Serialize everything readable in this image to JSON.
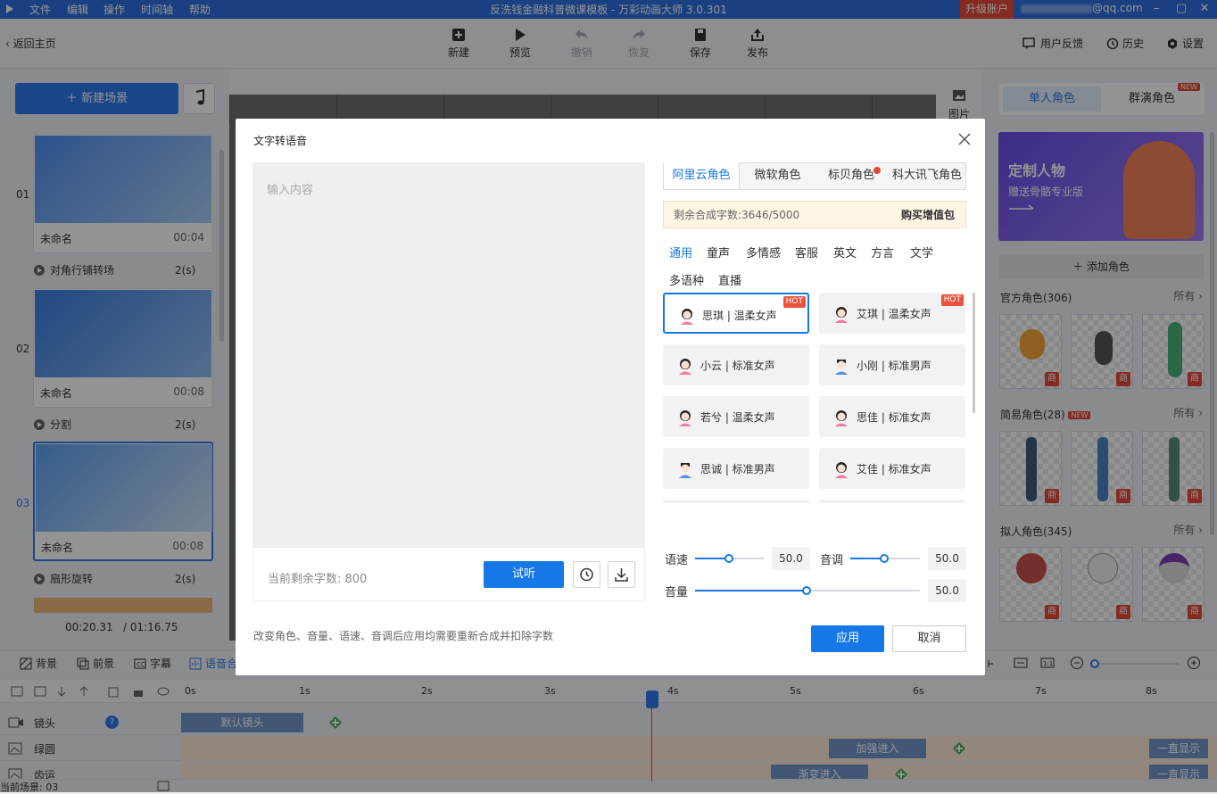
{
  "window": {
    "menus": [
      "文件",
      "编辑",
      "操作",
      "时间轴",
      "帮助"
    ],
    "title": "反洗钱金融科普微课模板 - 万彩动画大师 3.0.301",
    "upgrade": "升级账户",
    "account_suffix": "@qq.com"
  },
  "toolbar": {
    "back": "返回主页",
    "new": "新建",
    "preview": "预览",
    "undo": "撤销",
    "redo": "恢复",
    "save": "保存",
    "publish": "发布",
    "feedback": "用户反馈",
    "history": "历史",
    "settings": "设置"
  },
  "left": {
    "new_scene": "新建场景",
    "scenes": [
      {
        "num": "01",
        "name": "未命名",
        "time": "00:04",
        "trans": "对角行铺转场",
        "dur": "2(s)"
      },
      {
        "num": "02",
        "name": "未命名",
        "time": "00:08",
        "trans": "分割",
        "dur": "2(s)"
      },
      {
        "num": "03",
        "name": "未命名",
        "time": "00:08",
        "trans": "扇形旋转",
        "dur": "2(s)"
      }
    ],
    "current_time": "00:20.31",
    "total_time": "/ 01:16.75"
  },
  "right": {
    "tab_single": "单人角色",
    "tab_group": "群演角色",
    "new_badge": "NEW",
    "banner_title": "定制人物",
    "banner_sub": "赠送骨骼专业版",
    "add_role": "添加角色",
    "sections": [
      {
        "title": "官方角色(306)",
        "more": "所有"
      },
      {
        "title": "简易角色(28)",
        "more": "所有"
      },
      {
        "title": "拟人角色(345)",
        "more": "所有"
      }
    ],
    "shang": "商",
    "image_label": "图片"
  },
  "timeline": {
    "tabs": [
      "背景",
      "前景",
      "字幕",
      "语音合"
    ],
    "ruler": [
      "0s",
      "1s",
      "2s",
      "3s",
      "4s",
      "5s",
      "6s",
      "7s",
      "8s"
    ],
    "tracks": [
      {
        "label": "镜头",
        "clip": "默认镜头"
      },
      {
        "label": "绿圆",
        "clip": "加强进入",
        "end": "一直显示"
      },
      {
        "label": "齿运",
        "clip": "渐变进入",
        "end": "一直显示"
      }
    ],
    "status": "当前场景: 03"
  },
  "dialog": {
    "title": "文字转语音",
    "placeholder": "输入内容",
    "remaining_chars": "当前剩余字数: 800",
    "listen": "试听",
    "note": "改变角色、音量、语速、音调后应用均需要重新合成并扣除字数",
    "voice_tabs": [
      "阿里云角色",
      "微软角色",
      "标贝角色",
      "科大讯飞角色"
    ],
    "quota": "剩余合成字数:3646/5000",
    "buy": "购买增值包",
    "categories": [
      "通用",
      "童声",
      "多情感",
      "客服",
      "英文",
      "方言",
      "文学",
      "多语种",
      "直播"
    ],
    "voices": [
      {
        "label": "思琪 | 温柔女声",
        "hot": "HOT",
        "gender": "female"
      },
      {
        "label": "艾琪 | 温柔女声",
        "hot": "HOT",
        "gender": "female"
      },
      {
        "label": "小云 | 标准女声",
        "hot": "",
        "gender": "female"
      },
      {
        "label": "小刚 | 标准男声",
        "hot": "",
        "gender": "male"
      },
      {
        "label": "若兮 | 温柔女声",
        "hot": "",
        "gender": "female"
      },
      {
        "label": "思佳 | 标准女声",
        "hot": "",
        "gender": "female"
      },
      {
        "label": "思诚 | 标准男声",
        "hot": "",
        "gender": "male"
      },
      {
        "label": "艾佳 | 标准女声",
        "hot": "",
        "gender": "female"
      }
    ],
    "speed_label": "语速",
    "speed_value": "50.0",
    "pitch_label": "音调",
    "pitch_value": "50.0",
    "volume_label": "音量",
    "volume_value": "50.0",
    "speed_level": 0.5,
    "pitch_level": 0.5,
    "volume_level": 0.5,
    "apply": "应用",
    "cancel": "取消"
  },
  "colors": {
    "accent": "#1677e6",
    "titlebar": "#2e6fe0",
    "hot": "#e8553d"
  }
}
